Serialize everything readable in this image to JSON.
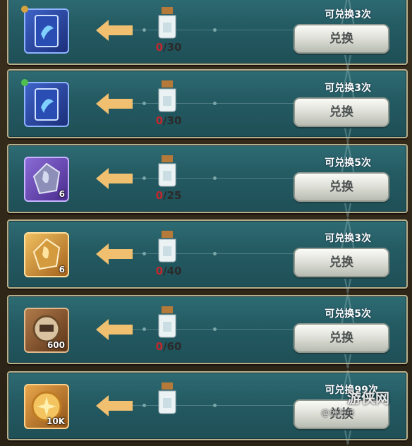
{
  "rows": [
    {
      "item_icon": "blue-card-icon",
      "badge": "gold-badge",
      "count": "",
      "progress_current": "0",
      "progress_total": "/30",
      "limit": "可兑换3次",
      "button": "兑换"
    },
    {
      "item_icon": "blue-card-icon",
      "badge": "green-dot-badge",
      "count": "",
      "progress_current": "0",
      "progress_total": "/30",
      "limit": "可兑换3次",
      "button": "兑换"
    },
    {
      "item_icon": "purple-stone-icon",
      "badge": "",
      "count": "6",
      "progress_current": "0",
      "progress_total": "/25",
      "limit": "可兑换5次",
      "button": "兑换"
    },
    {
      "item_icon": "gold-stone-icon",
      "badge": "",
      "count": "6",
      "progress_current": "0",
      "progress_total": "/40",
      "limit": "可兑换3次",
      "button": "兑换"
    },
    {
      "item_icon": "bronze-medal-icon",
      "badge": "",
      "count": "600",
      "progress_current": "0",
      "progress_total": "/60",
      "limit": "可兑换5次",
      "button": "兑换"
    },
    {
      "item_icon": "gold-coin-icon",
      "badge": "",
      "count": "10K",
      "progress_current": "",
      "progress_total": "",
      "limit": "可兑换99次",
      "button": "兑换"
    }
  ],
  "watermark": {
    "site": "游侠网",
    "handle": "@创与 3"
  }
}
